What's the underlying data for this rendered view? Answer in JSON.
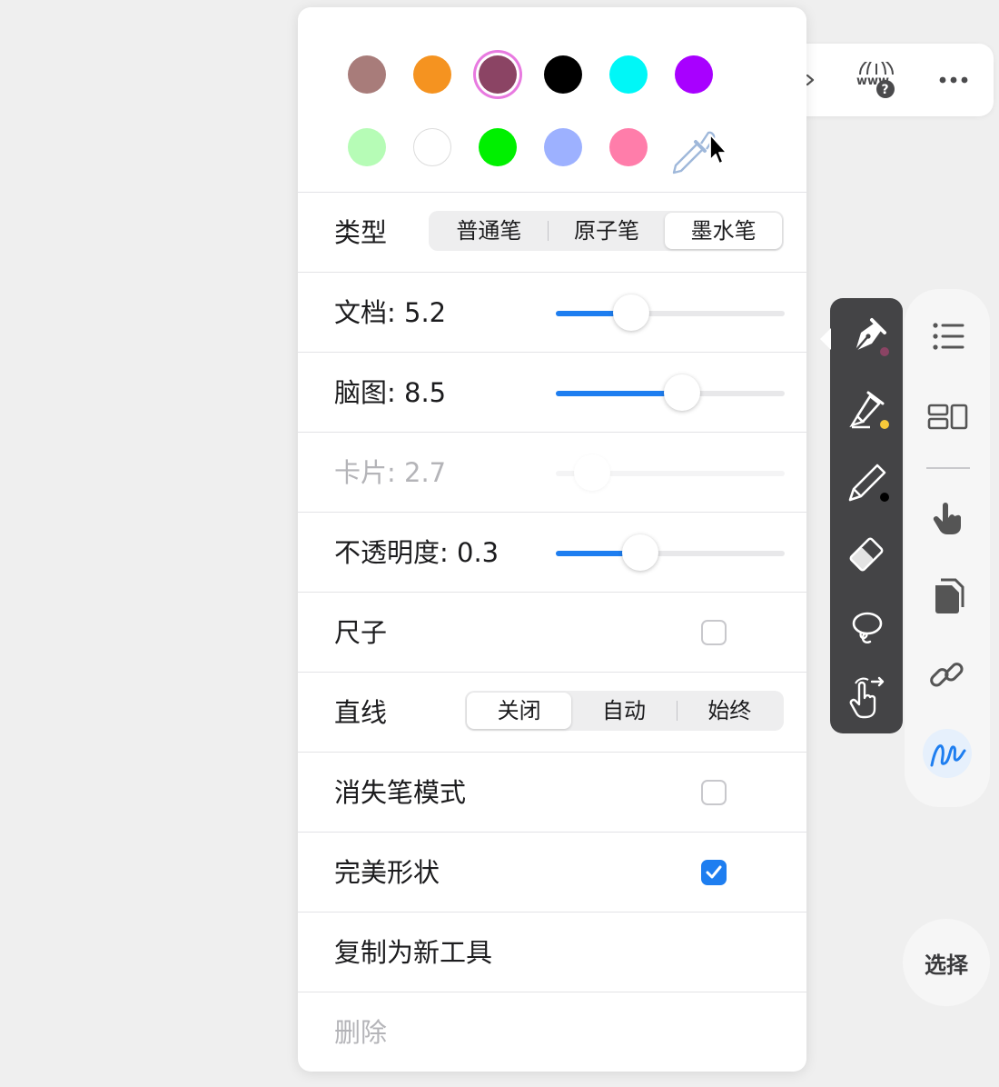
{
  "colors": {
    "accent": "#1e7ef0",
    "selected_ring": "#e87ae0",
    "toolbar_dark": "#444446"
  },
  "swatches": [
    {
      "name": "swatch-mauve",
      "color": "#a87c7a"
    },
    {
      "name": "swatch-orange",
      "color": "#f59320"
    },
    {
      "name": "swatch-plum",
      "color": "#8b4464",
      "selected": true
    },
    {
      "name": "swatch-black",
      "color": "#000000"
    },
    {
      "name": "swatch-cyan",
      "color": "#00f7f7"
    },
    {
      "name": "swatch-purple",
      "color": "#a800ff"
    },
    {
      "name": "swatch-light-green",
      "color": "#b6fcb6"
    },
    {
      "name": "swatch-white",
      "color": "#ffffff"
    },
    {
      "name": "swatch-green",
      "color": "#00f000"
    },
    {
      "name": "swatch-periwinkle",
      "color": "#9db1ff"
    },
    {
      "name": "swatch-pink",
      "color": "#ff7daa"
    }
  ],
  "eyedropper_icon": "eyedropper-icon",
  "type_row": {
    "label": "类型",
    "options": [
      "普通笔",
      "原子笔",
      "墨水笔"
    ],
    "selected": "墨水笔"
  },
  "sliders": {
    "document": {
      "label": "文档: 5.2",
      "fraction": 0.33
    },
    "mindmap": {
      "label": "脑图: 8.5",
      "fraction": 0.55
    },
    "card": {
      "label": "卡片: 2.7",
      "fraction": 0.16,
      "disabled": true
    },
    "opacity": {
      "label": "不透明度: 0.3",
      "fraction": 0.37
    }
  },
  "ruler": {
    "label": "尺子",
    "checked": false
  },
  "line_row": {
    "label": "直线",
    "options": [
      "关闭",
      "自动",
      "始终"
    ],
    "selected": "关闭"
  },
  "vanish_mode": {
    "label": "消失笔模式",
    "checked": false
  },
  "perfect_shape": {
    "label": "完美形状",
    "checked": true
  },
  "duplicate": {
    "label": "复制为新工具"
  },
  "delete": {
    "label": "删除"
  },
  "top_toolbar": {
    "icons": [
      "chevron-right-icon",
      "web-help-icon",
      "more-icon"
    ]
  },
  "pen_toolbar": {
    "tools": [
      {
        "name": "fountain-pen-tool",
        "icon": "fountain-pen-icon",
        "dot": "#8b4464"
      },
      {
        "name": "highlighter-tool",
        "icon": "highlighter-icon",
        "dot": "#f8c93a"
      },
      {
        "name": "pencil-tool",
        "icon": "pencil-icon",
        "dot": "#000000"
      },
      {
        "name": "eraser-tool",
        "icon": "eraser-icon"
      },
      {
        "name": "lasso-tool",
        "icon": "lasso-icon"
      },
      {
        "name": "pan-gesture-tool",
        "icon": "pan-gesture-icon"
      }
    ]
  },
  "side_toolbar": {
    "icons": [
      "outline-list-icon",
      "layout-icon",
      "hand-pointer-icon",
      "documents-icon",
      "link-icon",
      "scribble-icon"
    ]
  },
  "select_button": "选择"
}
